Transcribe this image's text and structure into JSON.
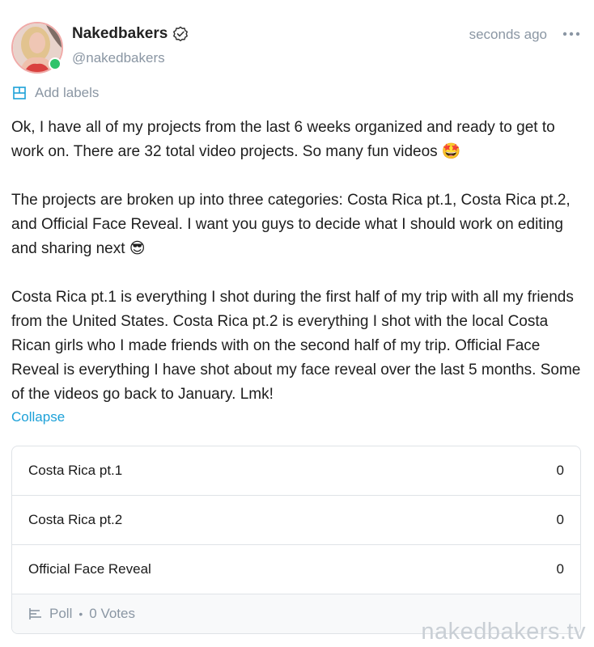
{
  "author": {
    "display_name": "Nakedbakers",
    "handle": "@nakedbakers",
    "online": true,
    "verified": true
  },
  "timestamp": "seconds ago",
  "more_icon": "more-horizontal-icon",
  "labels": {
    "text": "Add labels",
    "icon": "label-icon"
  },
  "post": {
    "paragraphs": [
      "Ok, I have all of my projects from the last 6 weeks organized and ready to get to work on. There are 32 total video projects. So many fun videos 🤩",
      "The projects are broken up into three categories: Costa Rica pt.1, Costa Rica pt.2, and Official Face Reveal. I want you guys to decide what I should work on editing and sharing next 😎",
      "Costa Rica pt.1 is everything I shot during the first half of my trip with all my friends from the United States. Costa Rica pt.2 is everything I shot with the local Costa Rican girls who I made friends with on the second half of my trip. Official Face Reveal is everything I have shot about my face reveal over the last 5 months. Some of the videos go back to January. Lmk!"
    ],
    "collapse_label": "Collapse"
  },
  "poll": {
    "options": [
      {
        "label": "Costa Rica pt.1",
        "votes": "0"
      },
      {
        "label": "Costa Rica pt.2",
        "votes": "0"
      },
      {
        "label": "Official Face Reveal",
        "votes": "0"
      }
    ],
    "footer_label": "Poll",
    "footer_separator": "•",
    "total_votes": "0 Votes"
  },
  "watermark": "nakedbakers.tv",
  "colors": {
    "accent": "#1da1d8",
    "muted": "#8a96a3",
    "online": "#2fc36a",
    "border": "#dfe3e7"
  }
}
